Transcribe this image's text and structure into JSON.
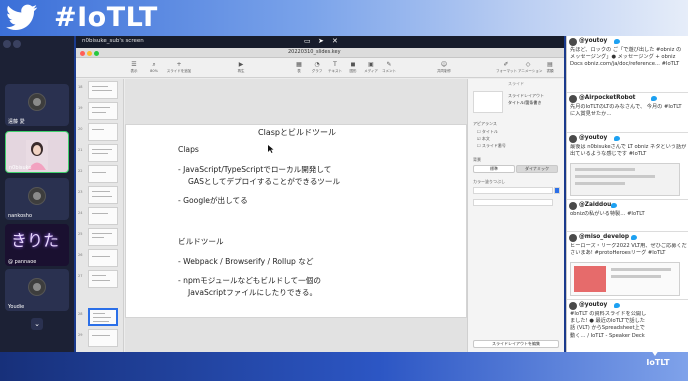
{
  "banner": {
    "hashtag": "#IoTLT",
    "bird_icon": "twitter-bird-icon",
    "background_gradient": [
      "#3b6fd8",
      "#e6edf9"
    ]
  },
  "participants": {
    "tiles": [
      {
        "name": "遠藤 愛",
        "kind": "avatar"
      },
      {
        "name": "n0bisuke",
        "kind": "video"
      },
      {
        "name": "nankosho",
        "kind": "avatar"
      },
      {
        "name": "@ pannaoe",
        "kind": "anime",
        "overlay": "きりた"
      },
      {
        "name": "Youdie",
        "kind": "avatar"
      }
    ],
    "scroll_down_icon": "chevron-down-icon"
  },
  "screen_share": {
    "title": "n0bisuke_sub's screen",
    "controls": [
      "monitor-icon",
      "cursor-icon",
      "close-icon"
    ]
  },
  "keynote": {
    "document_title": "20220310_slides.key",
    "toolbar_items": [
      {
        "label": "表示",
        "icon": "view-icon"
      },
      {
        "label": "80%",
        "icon": "zoom-icon"
      },
      {
        "label": "スライドを追加",
        "icon": "add-slide-icon"
      },
      {
        "label": "再生",
        "icon": "play-icon"
      },
      {
        "label": "表",
        "icon": "table-icon"
      },
      {
        "label": "グラフ",
        "icon": "chart-icon"
      },
      {
        "label": "テキスト",
        "icon": "text-icon"
      },
      {
        "label": "図形",
        "icon": "shape-icon"
      },
      {
        "label": "メディア",
        "icon": "media-icon"
      },
      {
        "label": "コメント",
        "icon": "comment-icon"
      },
      {
        "label": "共同制作",
        "icon": "collaborate-icon"
      },
      {
        "label": "フォーマット",
        "icon": "format-icon"
      },
      {
        "label": "アニメーション",
        "icon": "animate-icon"
      },
      {
        "label": "書類",
        "icon": "document-icon"
      }
    ],
    "slide_numbers": [
      "18",
      "19",
      "20",
      "21",
      "22",
      "23",
      "24",
      "25",
      "26",
      "27",
      "28",
      "29",
      "30"
    ],
    "selected_slide": "28"
  },
  "slide": {
    "title": "Claspとビルドツール",
    "section1_heading": "Claps",
    "bullet1_line1": "- JavaScript/TypeScriptでローカル開発して",
    "bullet1_line2": "GASとしてデプロイすることができるツール",
    "bullet2": "- Googleが出してる",
    "section2_heading": "ビルドツール",
    "bullet3": "- Webpack / Browserify / Rollup など",
    "bullet4_line1": "- npmモジュールなどもビルドして一個の",
    "bullet4_line2": "JavaScriptファイルにしたりできる。"
  },
  "inspector": {
    "header": "スライド",
    "layout_label": "スライドレイアウト",
    "layout_value": "タイトル/箇条書き",
    "appearance_label": "アピアランス",
    "checks": [
      "タイトル",
      "本文",
      "スライド番号"
    ],
    "background_label": "背景",
    "buttons": [
      "標準",
      "ダイナミック"
    ],
    "fill_label": "カラー塗りつぶし",
    "edit_button": "スライドレイアウトを編集"
  },
  "feed": {
    "tweets": [
      {
        "handle": "@youtoy",
        "body": "先ほど、ロックの ご「で遊び出した #obniz の メッセージング」● メッセージング + obniz Docs obniz.com/ja/doc/reference... #IoTLT"
      },
      {
        "handle": "@AirpocketRobot",
        "body": "先月のIoTLTのLTのみなさんで、 今月の #IoTLT に入賞見せたか…"
      },
      {
        "handle": "@youtoy",
        "body": "最後は n0bisukeさんで LT obniz ネタという話が出ているような感じです #IoTLT",
        "media": "tweet-image"
      },
      {
        "handle": "@Zaiddou",
        "body": "obnizの私がいる特製… #IoTLT"
      },
      {
        "handle": "@miso_develop",
        "body": "ヒーローズ・リーグ2022 VLT用、ぜひご応募くださいまあ! #protoHeroesリーグ #IoTLT",
        "media": "tweet-card"
      },
      {
        "handle": "@youtoy",
        "body": "#IoTLT の資料スライドを公開しました! ● 最近のIoTLTで話した話 (VLT) からSpreadsheet上で動く… / IoTLT - Speaker Deck"
      }
    ]
  },
  "logo": {
    "text": "IoTLT",
    "icon": "iotlt-logo-icon"
  },
  "colors": {
    "accent_blue": "#1da1f2",
    "keynote_selection": "#2b6fe8",
    "active_speaker": "#3fcf6c"
  }
}
